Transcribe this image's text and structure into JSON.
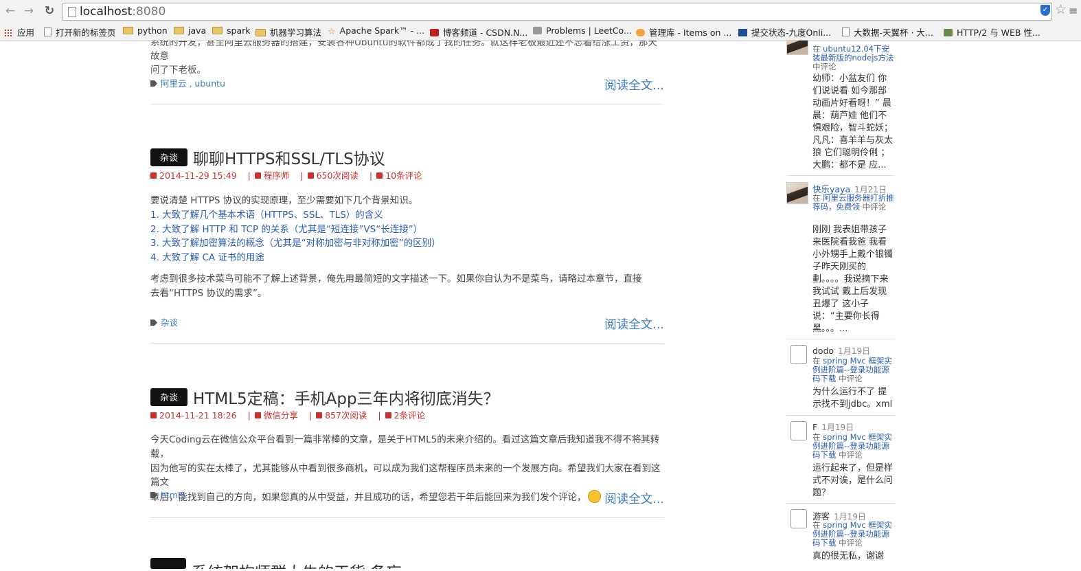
{
  "browser": {
    "url_host": "localhost",
    "url_port": ":8080",
    "bookmarks": [
      {
        "label": "应用",
        "icon": "apps-grid-icon"
      },
      {
        "label": "打开新的标签页",
        "icon": "page-icon"
      },
      {
        "label": "python",
        "icon": "folder-icon"
      },
      {
        "label": "java",
        "icon": "folder-icon"
      },
      {
        "label": "spark",
        "icon": "folder-icon"
      },
      {
        "label": "机器学习算法",
        "icon": "folder-icon"
      },
      {
        "label": "Apache Spark™ - ...",
        "icon": "spark-star-icon"
      },
      {
        "label": "博客频道 - CSDN.N...",
        "icon": "csdn-icon"
      },
      {
        "label": "Problems | LeetCo...",
        "icon": "leetcode-icon"
      },
      {
        "label": "管理库 - Items on ...",
        "icon": "manager-icon"
      },
      {
        "label": "提交状态-九度Onli...",
        "icon": "jiudu-icon"
      },
      {
        "label": "大数据-天翼杯 · 大...",
        "icon": "page-icon"
      },
      {
        "label": "HTTP/2 与 WEB 性...",
        "icon": "avatar-icon"
      }
    ]
  },
  "prev_post": {
    "tail_line1": "系统的开发，甚至阿里云服务器的搭建，安装各种Ubuntu的软件都成了我的任务。就这样老板最近还不忘着给涨工资，那天故意",
    "tail_line2": "问了下老板。",
    "tags": "阿里云 , ubuntu",
    "read_more": "阅读全文..."
  },
  "posts": [
    {
      "category": "杂谈",
      "title": "聊聊HTTPS和SSL/TLS协议",
      "date": "2014-11-29 15:49",
      "author": "程序师",
      "reads": "650次阅读",
      "comments": "10条评论",
      "intro": "要说清楚 HTTPS 协议的实现原理，至少需要如下几个背景知识。",
      "list": [
        "1. 大致了解几个基本术语（HTTPS、SSL、TLS）的含义",
        "2. 大致了解 HTTP 和 TCP 的关系（尤其是“短连接”VS“长连接”）",
        "3. 大致了解加密算法的概念（尤其是“对称加密与非对称加密”的区别）",
        "4. 大致了解 CA 证书的用途"
      ],
      "outro_line1": "考虑到很多技术菜鸟可能不了解上述背景，俺先用最简短的文字描述一下。如果你自认为不是菜鸟，请略过本章节，直接",
      "outro_line2": "去看“HTTPS 协议的需求”。",
      "tags": "杂谈",
      "read_more": "阅读全文..."
    },
    {
      "category": "杂谈",
      "title": "HTML5定稿：手机App三年内将彻底消失？",
      "date": "2014-11-21 18:26",
      "author": "微信分享",
      "reads": "857次阅读",
      "comments": "2条评论",
      "body_line1": "今天Coding云在微信公众平台看到一篇非常棒的文章，是关于HTML5的未来介绍的。看过这篇文章后我知道我不得不将其转载，",
      "body_line2": "因为他写的实在太棒了，尤其能够从中看到很多商机，可以成为我们这帮程序员未来的一个发展方向。希望我们大家在看到这篇文",
      "body_line3": "章后，能找到自己的方向，如果您真的从中受益，并且成功的话，希望您若干年后能回来为我们发个评论，",
      "tags": "html5",
      "read_more": "阅读全文..."
    },
    {
      "title_partial": "系统架构师群大牛的干货·备忘"
    }
  ],
  "sidebar_comments": [
    {
      "ref_link": "ubuntu12.04下安装最新版的nodejs方法",
      "text": "幼师：小盆友们 你们说说看 如今那部动画片好看呀！” 晨晨：葫芦娃 他们不惧艰险，智斗蛇妖；凡凡：喜羊羊与灰太狼 它们聪明伶俐 ；大鹏：都不是 应..."
    },
    {
      "name": "快乐yaya",
      "date": "1月21日",
      "ref_link": "阿里云服务器打折推荐码，免费领",
      "text": "刚刚 我表姐带孩子来医院看我爸 我看小外甥手上戴个银镯子昨天刚买的 劃。。。。我说摘下来我试试 戴上后发现丑爆了 这小子说：“主要你长得黑。。。..."
    },
    {
      "name": "dodo",
      "date": "1月19日",
      "ref_link": "spring Mvc 框架实例进阶篇--登录功能源码下载",
      "text": "为什么运行不了 提示找不到jdbc。xml"
    },
    {
      "name": "F",
      "date": "1月19日",
      "ref_link": "spring Mvc 框架实例进阶篇--登录功能源码下载",
      "text": "运行起来了，但是样式不对诶，是什么问题？"
    },
    {
      "name": "游客",
      "date": "1月19日",
      "ref_link": "spring Mvc 框架实例进阶篇--登录功能源码下载",
      "text": "真的很无私，谢谢"
    }
  ],
  "labels": {
    "at": "在",
    "commented": "中评论"
  }
}
